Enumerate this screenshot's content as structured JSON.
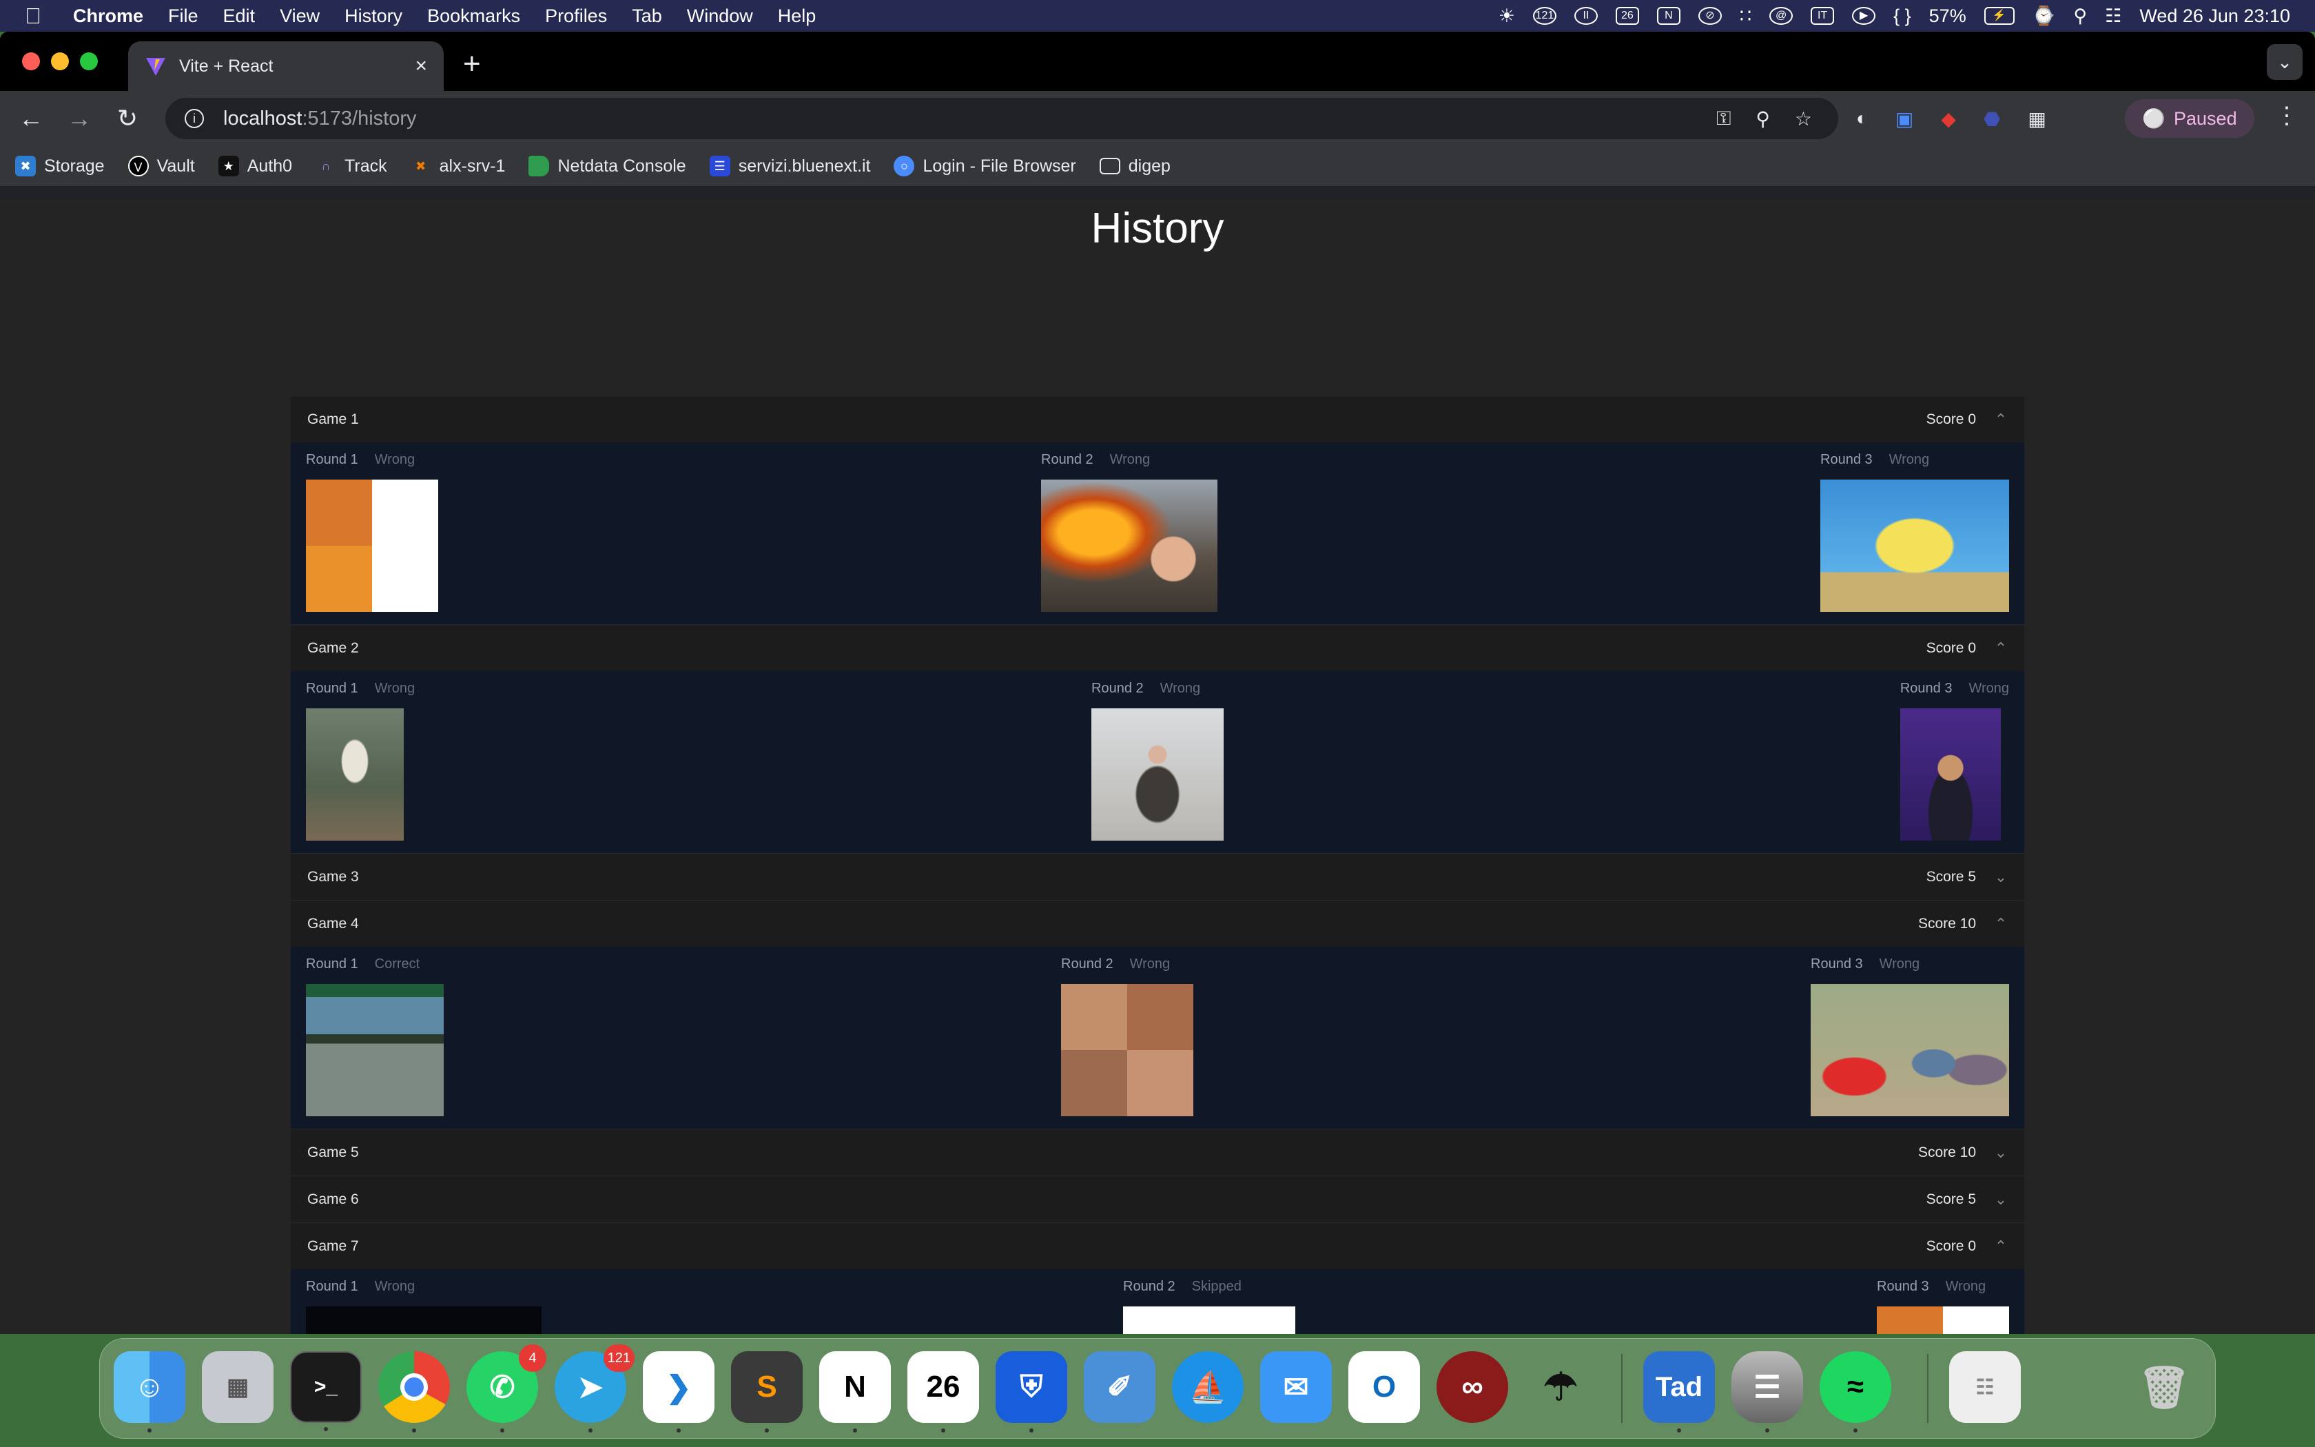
{
  "menubar": {
    "app": "Chrome",
    "items": [
      "File",
      "Edit",
      "View",
      "History",
      "Bookmarks",
      "Profiles",
      "Tab",
      "Window",
      "Help"
    ],
    "status": {
      "notif_count": "121",
      "calendar_day": "26",
      "lang": "IT",
      "battery": "57%",
      "datetime": "Wed 26 Jun  23:10"
    }
  },
  "browser": {
    "tab_title": "Vite + React",
    "url_host": "localhost",
    "url_path": ":5173/history",
    "profile_label": "Paused",
    "bookmarks": [
      "Storage",
      "Vault",
      "Auth0",
      "Track",
      "alx-srv-1",
      "Netdata Console",
      "servizi.bluenext.it",
      "Login - File Browser",
      "digep"
    ]
  },
  "page": {
    "title": "History",
    "score_label": "Score",
    "games": [
      {
        "name": "Game 1",
        "score": "0",
        "expanded": true,
        "rounds": [
          {
            "label": "Round 1",
            "status": "Wrong",
            "img": "drake-hotline-meme"
          },
          {
            "label": "Round 2",
            "status": "Wrong",
            "img": "disaster-girl-meme"
          },
          {
            "label": "Round 3",
            "status": "Wrong",
            "img": "mocking-spongebob-meme"
          }
        ]
      },
      {
        "name": "Game 2",
        "score": "0",
        "expanded": true,
        "rounds": [
          {
            "label": "Round 1",
            "status": "Wrong",
            "img": "waiting-skeleton-meme"
          },
          {
            "label": "Round 2",
            "status": "Wrong",
            "img": "bernie-asking-meme"
          },
          {
            "label": "Round 3",
            "status": "Wrong",
            "img": "trade-offer-meme"
          }
        ]
      },
      {
        "name": "Game 3",
        "score": "5",
        "expanded": false,
        "rounds": []
      },
      {
        "name": "Game 4",
        "score": "10",
        "expanded": true,
        "rounds": [
          {
            "label": "Round 1",
            "status": "Correct",
            "img": "left-exit-meme"
          },
          {
            "label": "Round 2",
            "status": "Wrong",
            "img": "anakin-padme-meme"
          },
          {
            "label": "Round 3",
            "status": "Wrong",
            "img": "distracted-boyfriend-meme"
          }
        ]
      },
      {
        "name": "Game 5",
        "score": "10",
        "expanded": false,
        "rounds": []
      },
      {
        "name": "Game 6",
        "score": "5",
        "expanded": false,
        "rounds": []
      },
      {
        "name": "Game 7",
        "score": "0",
        "expanded": true,
        "rounds": [
          {
            "label": "Round 1",
            "status": "Wrong",
            "img": "earth-astronaut-meme"
          },
          {
            "label": "Round 2",
            "status": "Skipped",
            "img": "doge-meme"
          },
          {
            "label": "Round 3",
            "status": "Wrong",
            "img": "drake-hotline-meme"
          }
        ]
      }
    ]
  },
  "dock": {
    "whatsapp_badge": "4",
    "telegram_badge": "121",
    "calendar_day": "26",
    "tad_label": "Tad",
    "items": [
      "finder",
      "launchpad",
      "terminal",
      "chrome",
      "whatsapp",
      "telegram",
      "vscode",
      "sublime",
      "notion",
      "calendar",
      "bitwarden",
      "fork",
      "docker",
      "mail",
      "outlook",
      "wireguard",
      "umbrella",
      "tad",
      "database",
      "spotify",
      "documents",
      "trash"
    ]
  }
}
